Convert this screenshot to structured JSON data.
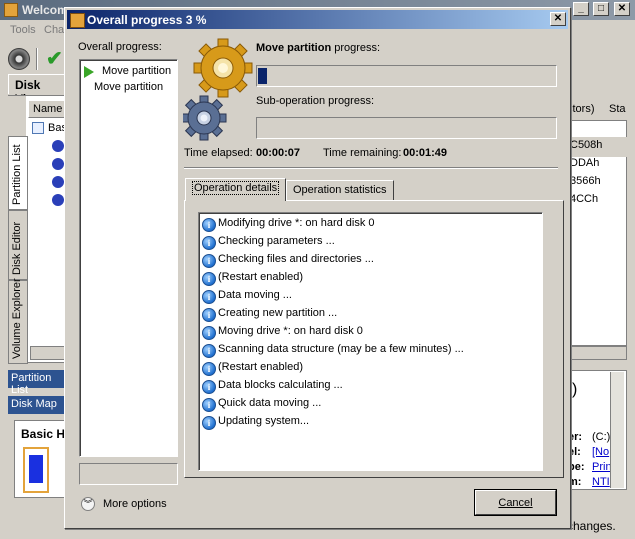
{
  "background_app": {
    "title": "Welcom",
    "menu": [
      "Tools",
      "Cha"
    ],
    "tab_label": "Disk View",
    "column_name": "Name",
    "tree_root": "Basi",
    "side_tabs": [
      "Partition List",
      "Disk Editor",
      "Volume Explorer"
    ],
    "partition_list_label": "Partition List",
    "disk_map_label": "Disk Map",
    "basic_label": "Basic H",
    "right_header": [
      "ctors)",
      "Sta"
    ],
    "right_values": [
      "C508h",
      "DDAh",
      "3566h",
      "4CCh"
    ],
    "right_info_labels": [
      "er:",
      "el:",
      "pe:",
      "m:"
    ],
    "right_info_values": [
      "(C:)",
      "[No",
      "Prin",
      "NTI"
    ],
    "paren": ")",
    "status_text": "changes."
  },
  "dialog": {
    "title": "Overall progress 3 %",
    "overall_label": "Overall progress:",
    "operations": [
      "Move partition",
      "Move partition"
    ],
    "progress_title_bold": "Move partition",
    "progress_title_rest": " progress:",
    "main_progress_pct": 3,
    "sub_label": "Sub-operation progress:",
    "sub_progress_pct": 0,
    "time_elapsed_label": "Time elapsed:",
    "time_elapsed": "00:00:07",
    "time_remaining_label": "Time remaining:",
    "time_remaining": "00:01:49",
    "tabs": [
      "Operation details",
      "Operation statistics"
    ],
    "log": [
      "Modifying drive *: on hard disk 0",
      "Checking parameters ...",
      "Checking files and directories ...",
      "(Restart enabled)",
      "Data moving ...",
      "Creating new partition ...",
      "Moving drive *: on hard disk 0",
      "Scanning data structure (may be a few minutes) ...",
      "(Restart enabled)",
      "Data blocks calculating ...",
      "Quick data moving ...",
      "Updating system..."
    ],
    "more_options": "More options",
    "cancel": "Cancel",
    "colors": {
      "title_start": "#0a246a",
      "title_end": "#a6caf0",
      "progress": "#0a246a",
      "arrow": "#3aa628"
    }
  }
}
